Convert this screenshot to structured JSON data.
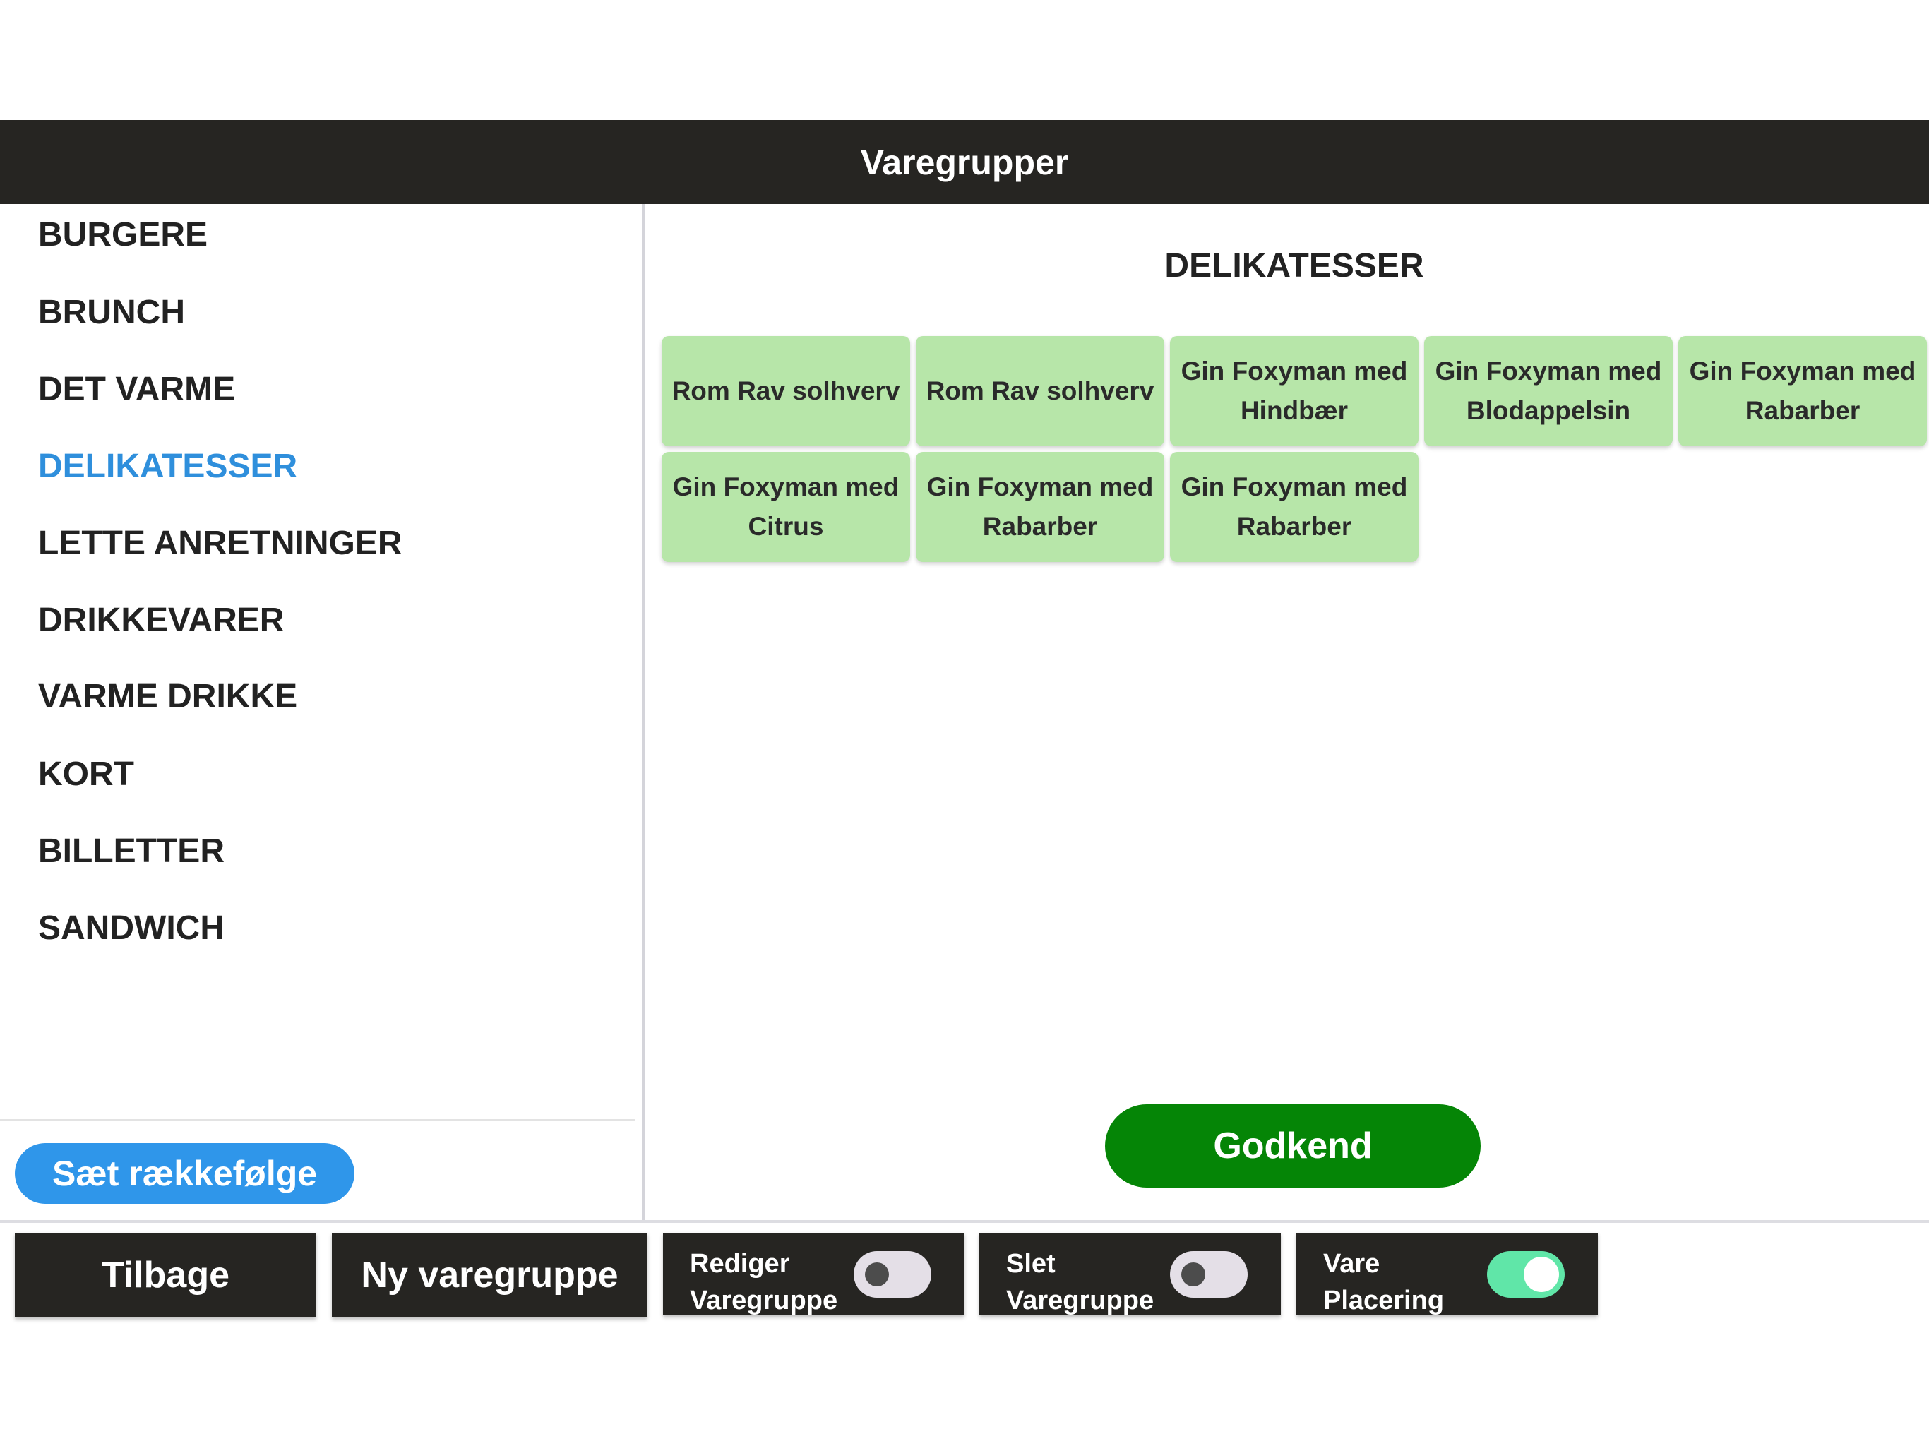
{
  "header": {
    "title": "Varegrupper"
  },
  "sidebar": {
    "groups": [
      {
        "label": "BURGERE"
      },
      {
        "label": "BRUNCH"
      },
      {
        "label": "DET VARME"
      },
      {
        "label": "DELIKATESSER",
        "active": true
      },
      {
        "label": "LETTE ANRETNINGER"
      },
      {
        "label": "DRIKKEVARER"
      },
      {
        "label": "VARME DRIKKE"
      },
      {
        "label": "KORT"
      },
      {
        "label": "BILLETTER"
      },
      {
        "label": "SANDWICH"
      }
    ],
    "order_button_label": "Sæt rækkefølge"
  },
  "main": {
    "section_title": "DELIKATESSER",
    "items": [
      {
        "label": "Rom Rav solhverv"
      },
      {
        "label": "Rom Rav solhverv"
      },
      {
        "label": "Gin Foxyman med Hindbær"
      },
      {
        "label": "Gin Foxyman med Blodappelsin"
      },
      {
        "label": "Gin Foxyman med Rabarber"
      },
      {
        "label": "Gin Foxyman med Citrus"
      },
      {
        "label": "Gin Foxyman med Rabarber"
      },
      {
        "label": "Gin Foxyman med Rabarber"
      }
    ],
    "approve_label": "Godkend"
  },
  "bottom": {
    "back_label": "Tilbage",
    "new_group_label": "Ny varegruppe",
    "toggles": [
      {
        "label": "Rediger\nVaregruppe",
        "on": false
      },
      {
        "label": "Slet\nVaregruppe",
        "on": false
      },
      {
        "label": "Vare\nPlacering",
        "on": true
      }
    ]
  },
  "colors": {
    "header_bg": "#262522",
    "active_group": "#2f8fdc",
    "item_card_bg": "#b7e6a9",
    "approve_bg": "#058506",
    "order_button_bg": "#2f96ea",
    "toggle_on": "#60e6a8",
    "toggle_off": "#e4dfe7"
  }
}
